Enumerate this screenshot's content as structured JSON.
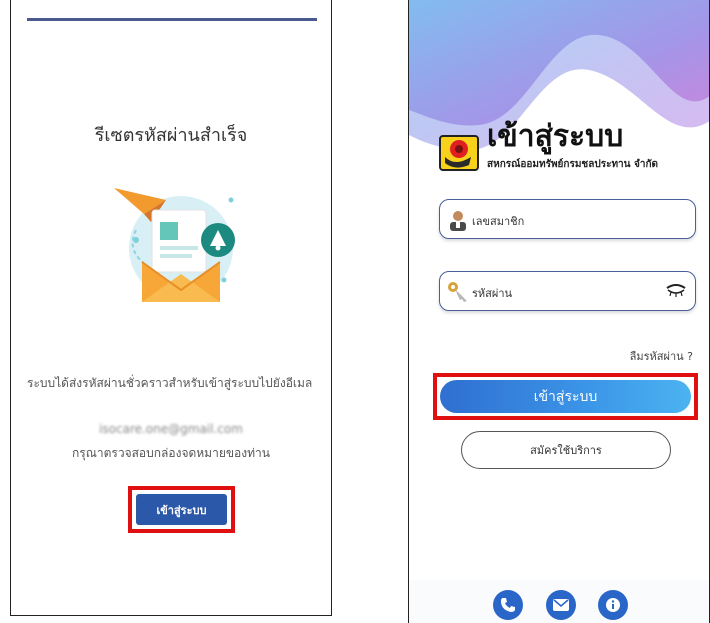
{
  "left_screen": {
    "title": "รีเซตรหัสผ่านสำเร็จ",
    "message": "ระบบได้ส่งรหัสผ่านชั่วคราวสำหรับเข้าสู่ระบบไปยังอีเมล",
    "email": "isocare.one@gmail.com",
    "instruction": "กรุณาตรวจสอบกล่องจดหมายของท่าน",
    "login_button_label": "เข้าสู่ระบบ",
    "illustration_icon": "envelope-paperplane-bell-icon"
  },
  "right_screen": {
    "title": "เข้าสู่ระบบ",
    "subtitle": "สหกรณ์ออมทรัพย์กรมชลประทาน จำกัด",
    "member_field_label": "เลขสมาชิก",
    "password_field_label": "รหัสผ่าน",
    "forgot_password": "ลืมรหัสผ่าน ?",
    "login_button_label": "เข้าสู่ระบบ",
    "register_button_label": "สมัครใช้บริการ",
    "bottom_icons": [
      "phone-icon",
      "mail-icon",
      "info-icon"
    ]
  },
  "colors": {
    "highlight": "#e01010",
    "primary_blue": "#2b58a8",
    "gradient_start": "#2f6fd0",
    "gradient_end": "#4cb3f0",
    "logo_yellow": "#f7d11a"
  }
}
